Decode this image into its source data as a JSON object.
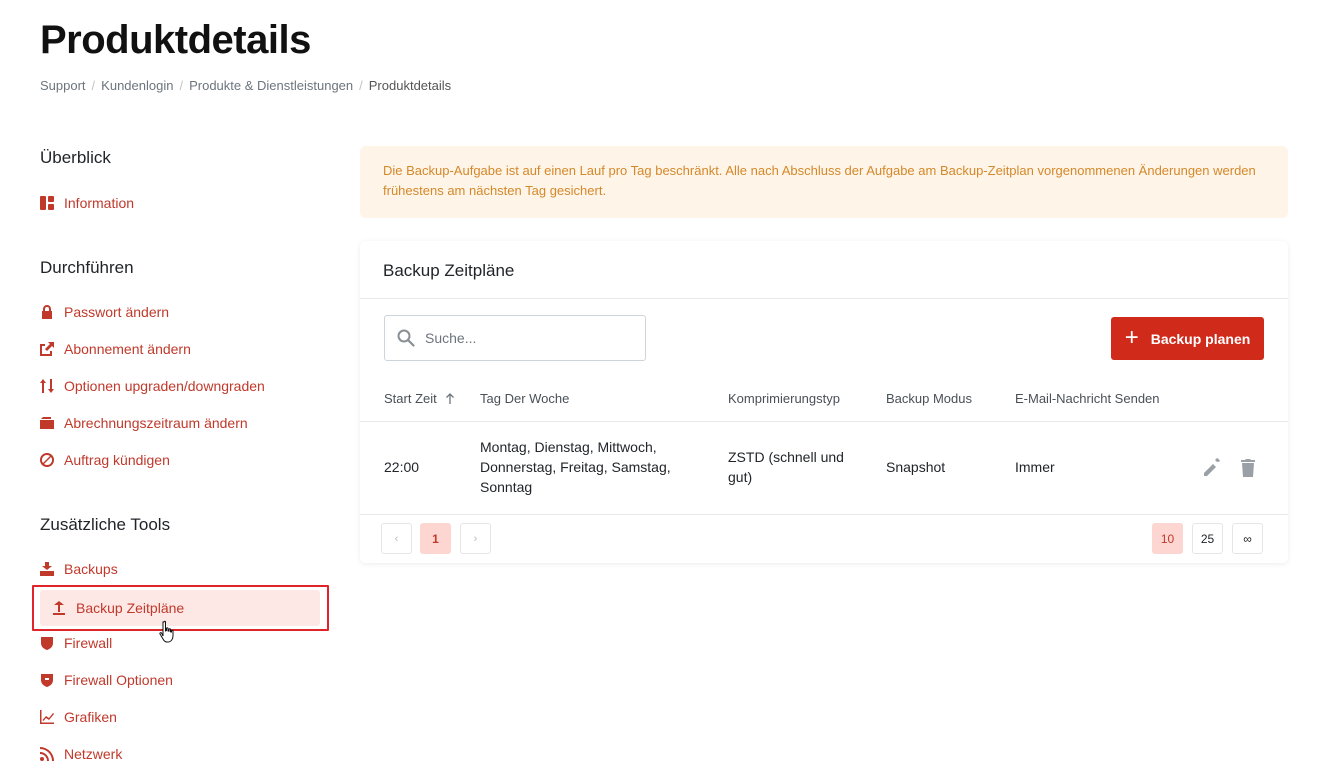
{
  "page": {
    "title": "Produktdetails",
    "breadcrumb": [
      "Support",
      "Kundenlogin",
      "Produkte & Dienstleistungen",
      "Produktdetails"
    ]
  },
  "sidebar": {
    "sections": [
      {
        "title": "Überblick",
        "items": [
          {
            "label": "Information",
            "icon": "dashboard-icon"
          }
        ]
      },
      {
        "title": "Durchführen",
        "items": [
          {
            "label": "Passwort ändern",
            "icon": "lock-icon"
          },
          {
            "label": "Abonnement ändern",
            "icon": "external-link-icon"
          },
          {
            "label": "Optionen upgraden/downgraden",
            "icon": "swap-vertical-icon"
          },
          {
            "label": "Abrechnungszeitraum ändern",
            "icon": "wallet-icon"
          },
          {
            "label": "Auftrag kündigen",
            "icon": "cancel-icon"
          }
        ]
      },
      {
        "title": "Zusätzliche Tools",
        "items": [
          {
            "label": "Backups",
            "icon": "backup-icon"
          },
          {
            "label": "Backup Zeitpläne",
            "icon": "upload-icon",
            "active": true
          },
          {
            "label": "Firewall",
            "icon": "shield-icon"
          },
          {
            "label": "Firewall Optionen",
            "icon": "shield-alert-icon"
          },
          {
            "label": "Grafiken",
            "icon": "chart-line-icon"
          },
          {
            "label": "Netzwerk",
            "icon": "rss-icon"
          }
        ]
      }
    ]
  },
  "alert": {
    "text": "Die Backup-Aufgabe ist auf einen Lauf pro Tag beschränkt. Alle nach Abschluss der Aufgabe am Backup-Zeitplan vorgenommenen Änderungen werden frühestens am nächsten Tag gesichert."
  },
  "card": {
    "title": "Backup Zeitpläne",
    "search_placeholder": "Suche...",
    "add_button": "Backup planen",
    "columns": [
      "Start Zeit",
      "Tag Der Woche",
      "Komprimierungstyp",
      "Backup Modus",
      "E-Mail-Nachricht Senden"
    ],
    "rows": [
      {
        "start": "22:00",
        "days": "Montag, Dienstag, Mittwoch, Donnerstag, Freitag, Samstag, Sonntag",
        "compression": "ZSTD (schnell und gut)",
        "mode": "Snapshot",
        "email": "Immer"
      }
    ],
    "pagination": {
      "prev": "‹",
      "current": "1",
      "next": "›",
      "page_sizes": [
        "10",
        "25",
        "∞"
      ],
      "selected_size": "10"
    }
  },
  "colors": {
    "accent": "#d02a1b",
    "alert_bg": "#fef5e8",
    "alert_text": "#d4882a",
    "active_bg": "#fde8e6"
  }
}
